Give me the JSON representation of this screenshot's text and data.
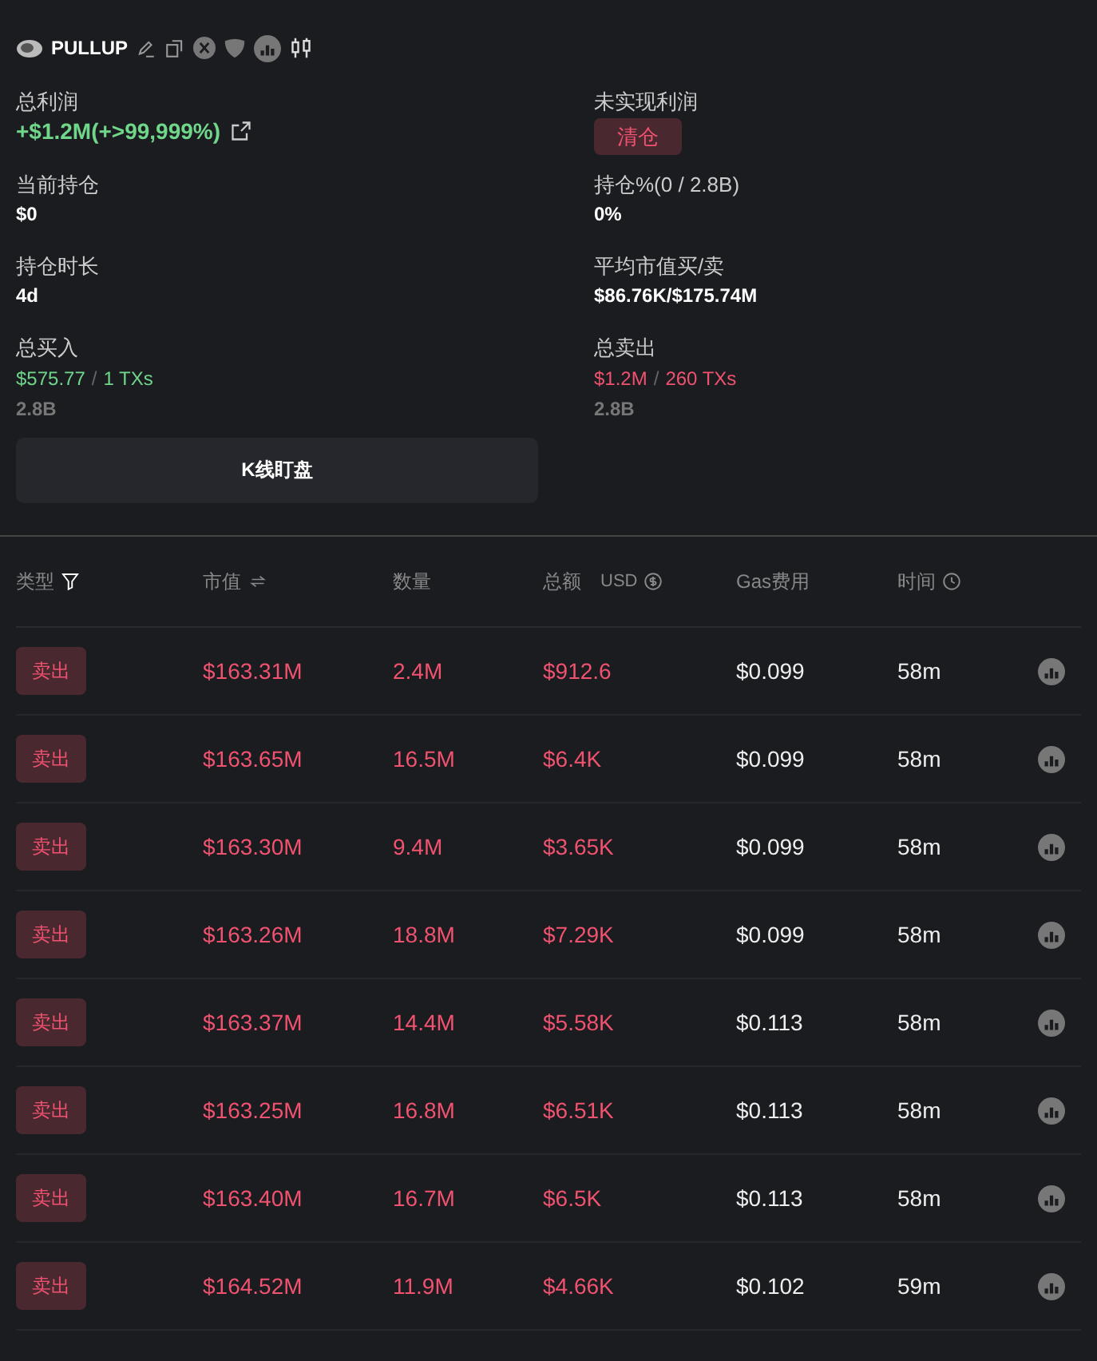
{
  "token": {
    "symbol": "PULLUP"
  },
  "stats": [
    {
      "kind": "profit",
      "label": "总利润",
      "value": "+$1.2M(+>99,999%)"
    },
    {
      "kind": "action",
      "label": "未实现利润",
      "button": "清仓"
    },
    {
      "kind": "plain",
      "label": "当前持仓",
      "value": "$0"
    },
    {
      "kind": "plain",
      "label": "持仓%(0 / 2.8B)",
      "value": "0%"
    },
    {
      "kind": "plain",
      "label": "持仓时长",
      "value": "4d"
    },
    {
      "kind": "plain",
      "label": "平均市值买/卖",
      "value": "$86.76K/$175.74M"
    },
    {
      "kind": "buy",
      "label": "总买入",
      "amount": "$575.77",
      "separator": "/",
      "txs": "1 TXs",
      "sub": "2.8B"
    },
    {
      "kind": "sell",
      "label": "总卖出",
      "amount": "$1.2M",
      "separator": "/",
      "txs": "260 TXs",
      "sub": "2.8B"
    }
  ],
  "kline_button": "K线盯盘",
  "table": {
    "columns": [
      {
        "label": "类型"
      },
      {
        "label": "市值"
      },
      {
        "label": "数量"
      },
      {
        "label": "总额",
        "unit": "USD"
      },
      {
        "label": "Gas费用"
      },
      {
        "label": "时间"
      }
    ],
    "rows": [
      {
        "type": "卖出",
        "kind": "sell",
        "mcap": "$163.31M",
        "qty": "2.4M",
        "total": "$912.6",
        "gas": "$0.099",
        "time": "58m"
      },
      {
        "type": "卖出",
        "kind": "sell",
        "mcap": "$163.65M",
        "qty": "16.5M",
        "total": "$6.4K",
        "gas": "$0.099",
        "time": "58m"
      },
      {
        "type": "卖出",
        "kind": "sell",
        "mcap": "$163.30M",
        "qty": "9.4M",
        "total": "$3.65K",
        "gas": "$0.099",
        "time": "58m"
      },
      {
        "type": "卖出",
        "kind": "sell",
        "mcap": "$163.26M",
        "qty": "18.8M",
        "total": "$7.29K",
        "gas": "$0.099",
        "time": "58m"
      },
      {
        "type": "卖出",
        "kind": "sell",
        "mcap": "$163.37M",
        "qty": "14.4M",
        "total": "$5.58K",
        "gas": "$0.113",
        "time": "58m"
      },
      {
        "type": "卖出",
        "kind": "sell",
        "mcap": "$163.25M",
        "qty": "16.8M",
        "total": "$6.51K",
        "gas": "$0.113",
        "time": "58m"
      },
      {
        "type": "卖出",
        "kind": "sell",
        "mcap": "$163.40M",
        "qty": "16.7M",
        "total": "$6.5K",
        "gas": "$0.113",
        "time": "58m"
      },
      {
        "type": "卖出",
        "kind": "sell",
        "mcap": "$164.52M",
        "qty": "11.9M",
        "total": "$4.66K",
        "gas": "$0.102",
        "time": "59m"
      }
    ]
  }
}
